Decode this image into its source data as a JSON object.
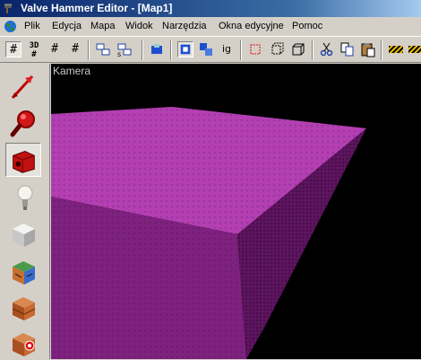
{
  "window": {
    "title": "Valve Hammer Editor - [Map1]"
  },
  "menu": {
    "items": [
      {
        "label": "Plik",
        "left": 0
      },
      {
        "label": "Edycja"
      },
      {
        "label": "Mapa"
      },
      {
        "label": "Widok"
      },
      {
        "label": "Narzędzia"
      },
      {
        "label": "Okna edycyjne"
      },
      {
        "label": "Pomoc"
      }
    ]
  },
  "toolbar": {
    "buttons": [
      {
        "name": "grid-toggle-icon",
        "pressed": true
      },
      {
        "name": "3d-grid-icon",
        "label": "3D"
      },
      {
        "name": "smaller-grid-icon"
      },
      {
        "name": "larger-grid-icon"
      },
      {
        "name": "load-window-state-icon"
      },
      {
        "name": "save-window-state-icon"
      },
      {
        "name": "carve-icon"
      },
      {
        "name": "group-icon"
      },
      {
        "name": "ungroup-icon"
      },
      {
        "name": "ignore-grouping-icon",
        "label": "ig"
      },
      {
        "name": "hide-selected-icon"
      },
      {
        "name": "show-all-icon"
      },
      {
        "name": "box-icon"
      },
      {
        "name": "cut-icon"
      },
      {
        "name": "copy-icon"
      },
      {
        "name": "paste-icon"
      },
      {
        "name": "texture-lock-icon"
      },
      {
        "name": "texture-scale-lock-icon"
      }
    ]
  },
  "tools": [
    {
      "name": "selection-tool-icon"
    },
    {
      "name": "magnify-tool-icon"
    },
    {
      "name": "camera-tool-icon",
      "pressed": true
    },
    {
      "name": "entity-tool-icon"
    },
    {
      "name": "block-tool-icon"
    },
    {
      "name": "texture-application-tool-icon"
    },
    {
      "name": "apply-current-texture-icon"
    },
    {
      "name": "decal-tool-icon"
    }
  ],
  "viewport": {
    "label": "Kamera",
    "face_colors": [
      "#b33fb3",
      "#7f217f",
      "#5e1460"
    ]
  }
}
